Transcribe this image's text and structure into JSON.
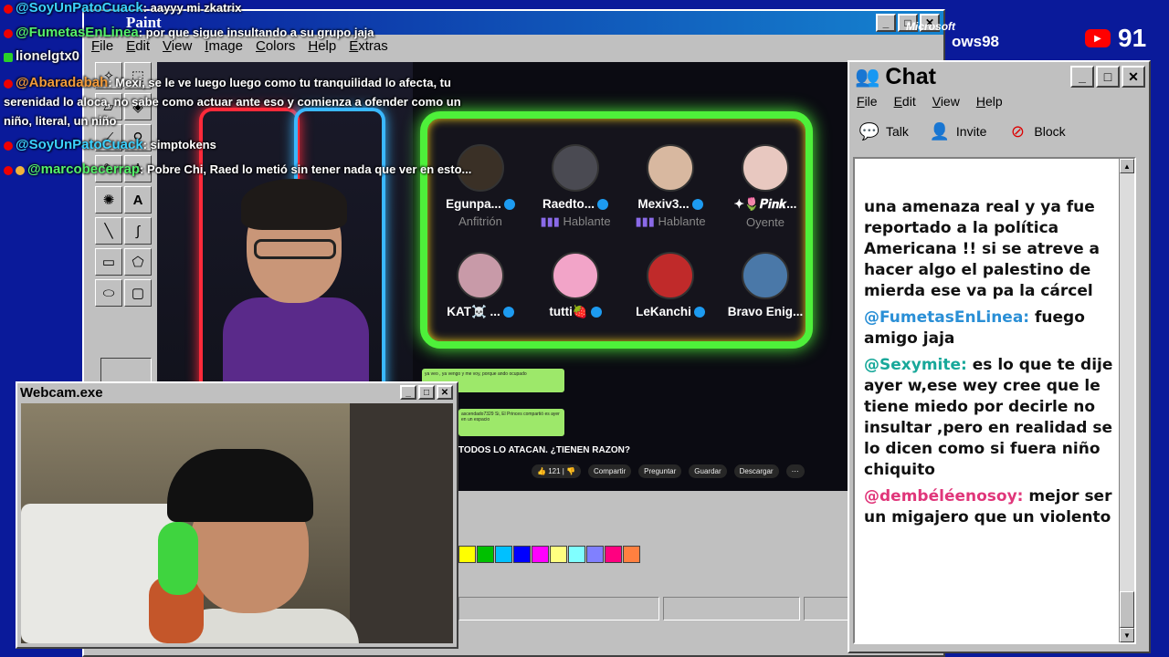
{
  "overlay_chat": [
    {
      "badge": "red",
      "user": "@SoyUnPatoCuack",
      "text": ": aayyy mi zkatrix",
      "color": "blue"
    },
    {
      "badge": "red",
      "user": "@FumetasEnLinea",
      "text": ": por que sigue insultando a su grupo jaja",
      "color": "green"
    },
    {
      "badge": "k",
      "user": "lionelgtx0",
      "text": "",
      "color": "white"
    },
    {
      "badge": "red",
      "user": "@Abaradabah",
      "text": ": Mexi, se le ve luego luego como tu tranquilidad lo afecta, tu serenidad lo aloca, no sabe como actuar ante eso y comienza a ofender como un niño, literal, un niño",
      "color": "orange"
    },
    {
      "badge": "red",
      "user": "@SoyUnPatoCuack",
      "text": ": simptokens",
      "color": "blue"
    },
    {
      "badge": "red",
      "user": "@marcobecerrap",
      "text": ": Pobre Chi, Raed lo metió sin tener nada que ver en esto...",
      "color": "green"
    }
  ],
  "paint": {
    "title": "Paint",
    "menu": [
      "File",
      "Edit",
      "View",
      "Image",
      "Colors",
      "Help",
      "Extras"
    ]
  },
  "space": {
    "members": [
      {
        "name": "Egunpa...",
        "role": "Anfitrión",
        "color": "#3a3026"
      },
      {
        "name": "Raedto...",
        "role": "Hablante",
        "color": "#4a4a52"
      },
      {
        "name": "Mexiv3...",
        "role": "Hablante",
        "color": "#d8b8a0"
      },
      {
        "name": "✦🌷𝑷𝒊𝒏𝒌...",
        "role": "Oyente",
        "color": "#e8c8c0"
      },
      {
        "name": "KAT☠️ ...",
        "role": "",
        "color": "#c89aa8"
      },
      {
        "name": "tutti🍓",
        "role": "",
        "color": "#f2a4c8"
      },
      {
        "name": "LeKanchi",
        "role": "",
        "color": "#c02a2a"
      },
      {
        "name": "Bravo Enig...",
        "role": "",
        "color": "#4a78a8"
      }
    ]
  },
  "youtube": {
    "title": "TODOS LO ATACAN. ¿TIENEN RAZON?",
    "likes": "121",
    "share": "Compartir",
    "ask": "Preguntar",
    "save": "Guardar",
    "download": "Descargar",
    "note1": "ya veo , ya vengo y me voy, porque ando ocupado",
    "note2": "ascendado7329 Si, El Princes compartió es ayer en un espacio"
  },
  "palette": [
    "#ffff00",
    "#00c000",
    "#00c0ff",
    "#0000ff",
    "#ff00ff",
    "#ffff80",
    "#80ffff",
    "#8080ff",
    "#ff0080",
    "#ff8040"
  ],
  "webcam": {
    "title": "Webcam.exe"
  },
  "chat": {
    "title": "Chat",
    "menu": [
      "File",
      "Edit",
      "View",
      "Help"
    ],
    "toolbar": {
      "talk": "Talk",
      "invite": "Invite",
      "block": "Block"
    },
    "messages": [
      {
        "user": "",
        "text": "una amenaza real y ya fue reportado a la política Americana !! si se atreve a hacer algo el palestino de mierda ese va pa la cárcel",
        "color": "blue"
      },
      {
        "user": "@FumetasEnLinea:",
        "text": " fuego amigo jaja",
        "color": "blue"
      },
      {
        "user": "@Sexymite:",
        "text": " es lo que te dije ayer w,ese wey cree que le tiene miedo por decirle no insultar ,pero en realidad se lo dicen como si fuera niño chiquito",
        "color": "teal"
      },
      {
        "user": "@dembéléenosoy:",
        "text": " mejor ser un migajero que un violento",
        "color": "pink"
      }
    ]
  },
  "brand": {
    "ms": "Microsoft",
    "win": "ows98"
  },
  "viewers": "91"
}
